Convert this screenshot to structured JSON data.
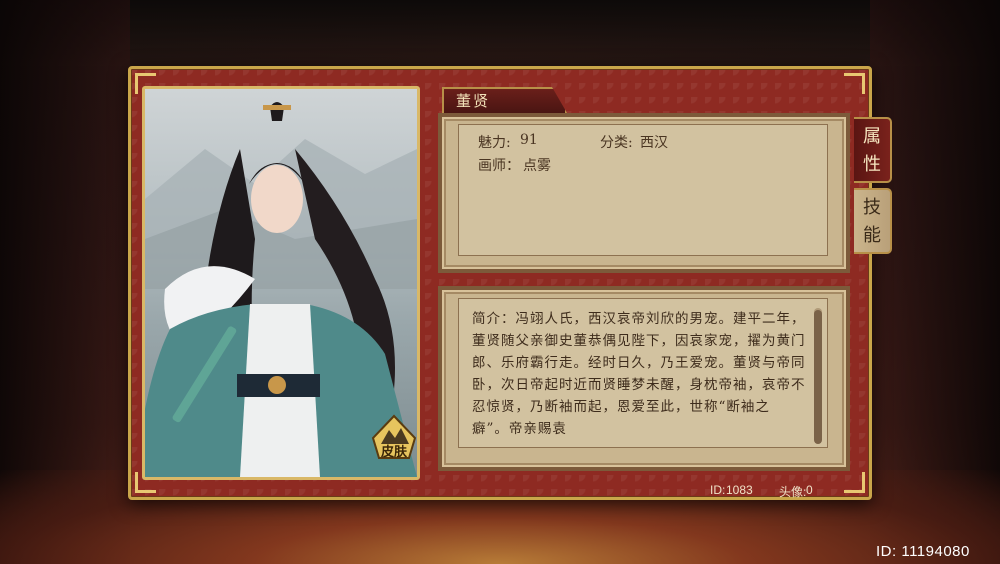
{
  "character": {
    "name": "董贤",
    "charm_label": "魅力:",
    "charm_value": "91",
    "category_label": "分类:",
    "category_value": "西汉",
    "artist_label": "画师：",
    "artist_value": "点雾"
  },
  "skin_button": {
    "label": "皮肤"
  },
  "tabs": {
    "attributes": "属\n性",
    "skills": "技\n能"
  },
  "bio": {
    "text": "简介：冯翊人氏，西汉哀帝刘欣的男宠。建平二年，董贤随父亲御史董恭偶见陛下，因哀家宠，擢为黄门郎、乐府霸行走。经时日久，乃王爱宠。董贤与帝同卧，次日帝起时近而贤睡梦未醒，身枕帝袖，哀帝不忍惊贤，乃断袖而起，恩爱至此，世称“断袖之癖”。帝亲赐袁"
  },
  "footer": {
    "id_label": "ID:",
    "id_value": "1083",
    "avatar_label": "头像:",
    "avatar_value": "0"
  },
  "global": {
    "id_text": "ID: 11194080"
  }
}
